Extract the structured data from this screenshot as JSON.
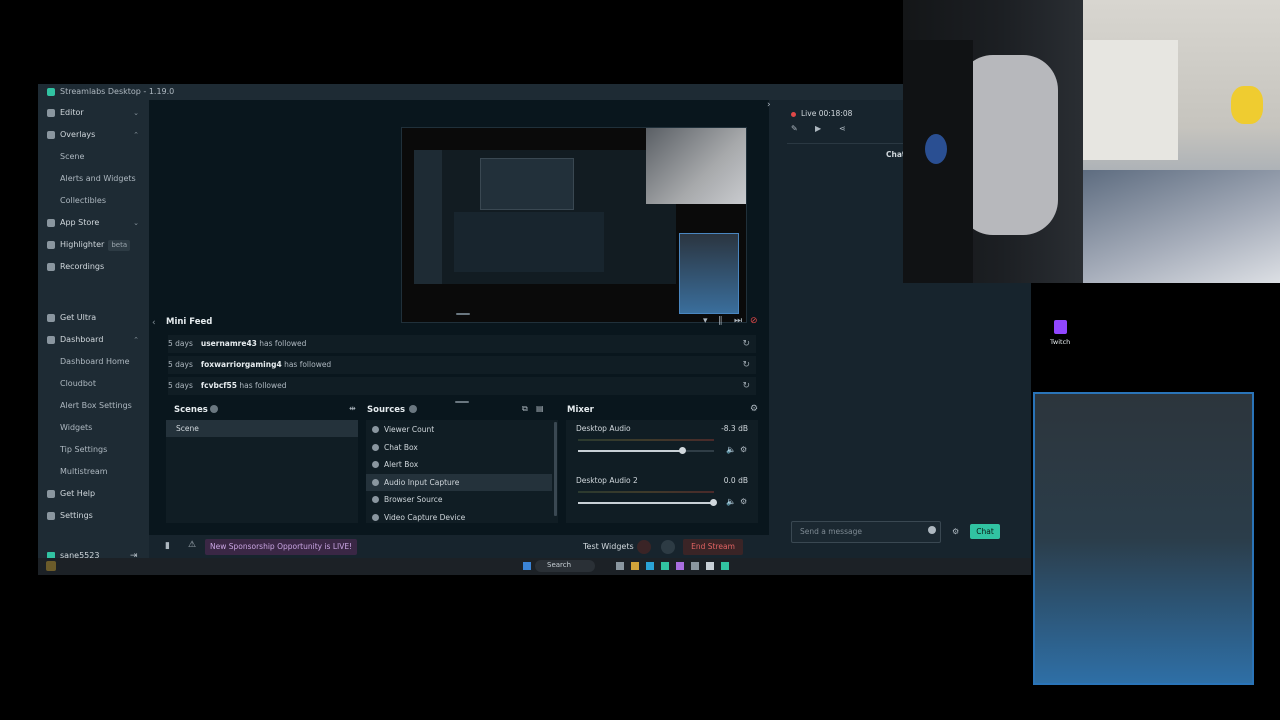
{
  "app": {
    "title": "Streamlabs Desktop - 1.19.0"
  },
  "sidebar": {
    "items": [
      {
        "label": "Editor",
        "chevron": "⌄"
      },
      {
        "label": "Overlays",
        "chevron": "⌃"
      },
      {
        "label": "Scene"
      },
      {
        "label": "Alerts and Widgets"
      },
      {
        "label": "Collectibles"
      },
      {
        "label": "App Store",
        "chevron": "⌄"
      },
      {
        "label": "Highlighter",
        "badge": "beta"
      },
      {
        "label": "Recordings"
      },
      {
        "label": "Get Ultra"
      },
      {
        "label": "Dashboard",
        "chevron": "⌃"
      },
      {
        "label": "Dashboard Home"
      },
      {
        "label": "Cloudbot"
      },
      {
        "label": "Alert Box Settings"
      },
      {
        "label": "Widgets"
      },
      {
        "label": "Tip Settings"
      },
      {
        "label": "Multistream"
      },
      {
        "label": "Get Help"
      },
      {
        "label": "Settings"
      }
    ],
    "user": "sane5523"
  },
  "mini_feed": {
    "title": "Mini Feed",
    "rows": [
      {
        "time": "5 days",
        "user": "usernamre43",
        "action": "has followed"
      },
      {
        "time": "5 days",
        "user": "foxwarriorgaming4",
        "action": "has followed"
      },
      {
        "time": "5 days",
        "user": "fcvbcf55",
        "action": "has followed"
      }
    ]
  },
  "scenes": {
    "title": "Scenes",
    "items": [
      "Scene"
    ]
  },
  "sources": {
    "title": "Sources",
    "items": [
      "Viewer Count",
      "Chat Box",
      "Alert Box",
      "Audio Input Capture",
      "Browser Source",
      "Video Capture Device"
    ],
    "selected": "Audio Input Capture"
  },
  "mixer": {
    "title": "Mixer",
    "channels": [
      {
        "name": "Desktop Audio",
        "db": "-8.3 dB",
        "level": 0.77
      },
      {
        "name": "Desktop Audio 2",
        "db": "0.0 dB",
        "level": 1.0
      }
    ]
  },
  "footer": {
    "sponsor": "New Sponsorship Opportunity is LIVE!",
    "test_widgets": "Test Widgets",
    "end_stream": "End Stream"
  },
  "live": {
    "status": "Live 00:18:08"
  },
  "chat": {
    "tab": "Chat",
    "placeholder": "Send a message",
    "button": "Chat"
  },
  "taskbar": {
    "search": "Search"
  },
  "desktop": {
    "twitch_label": "Twitch"
  },
  "colors": {
    "accent": "#31c3a2",
    "end_stream": "#e06363",
    "live_dot": "#e04848",
    "sponsor": "#c9a4e2"
  }
}
